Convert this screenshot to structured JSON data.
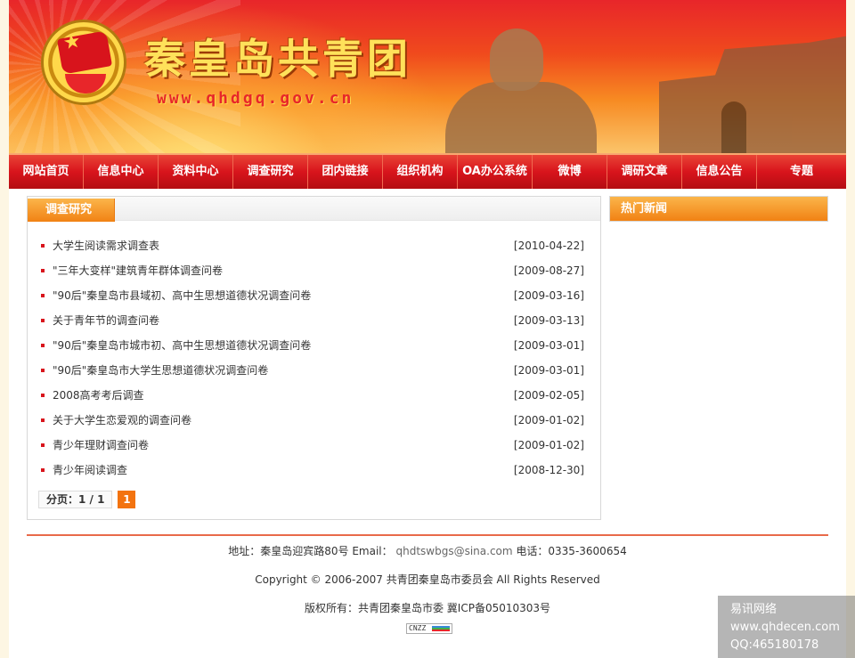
{
  "header": {
    "title": "秦皇岛共青团",
    "url": "www.qhdgq.gov.cn"
  },
  "nav": [
    {
      "label": "网站首页",
      "w": 84
    },
    {
      "label": "信息中心",
      "w": 84
    },
    {
      "label": "资料中心",
      "w": 84
    },
    {
      "label": "调查研究",
      "w": 84
    },
    {
      "label": "团内链接",
      "w": 84
    },
    {
      "label": "组织机构",
      "w": 84
    },
    {
      "label": "OA办公系统",
      "w": 84
    },
    {
      "label": "微博",
      "w": 84
    },
    {
      "label": "调研文章",
      "w": 84
    },
    {
      "label": "信息公告",
      "w": 84
    },
    {
      "label": "专题",
      "w": 100
    }
  ],
  "survey": {
    "title": "调查研究",
    "items": [
      {
        "title": "大学生阅读需求调查表",
        "date": "[2010-04-22]"
      },
      {
        "title": "\"三年大变样\"建筑青年群体调查问卷",
        "date": "[2009-08-27]"
      },
      {
        "title": "\"90后\"秦皇岛市县域初、高中生思想道德状况调查问卷",
        "date": "[2009-03-16]"
      },
      {
        "title": "关于青年节的调查问卷",
        "date": "[2009-03-13]"
      },
      {
        "title": "\"90后\"秦皇岛市城市初、高中生思想道德状况调查问卷",
        "date": "[2009-03-01]"
      },
      {
        "title": "\"90后\"秦皇岛市大学生思想道德状况调查问卷",
        "date": "[2009-03-01]"
      },
      {
        "title": "2008高考考后调查",
        "date": "[2009-02-05]"
      },
      {
        "title": "关于大学生恋爱观的调查问卷",
        "date": "[2009-01-02]"
      },
      {
        "title": "青少年理财调查问卷",
        "date": "[2009-01-02]"
      },
      {
        "title": "青少年阅读调查",
        "date": "[2008-12-30]"
      }
    ],
    "pager": {
      "info": "分页：1 / 1",
      "current": "1"
    }
  },
  "hot_news": {
    "title": "热门新闻"
  },
  "footer": {
    "address": "地址：秦皇岛迎宾路80号 Email：",
    "email": "qhdtswbgs@sina.com",
    "phone": " 电话：0335-3600654",
    "copyright": "Copyright © 2006-2007 共青团秦皇岛市委员会 All Rights Reserved",
    "owner": "版权所有：共青团秦皇岛市委 冀ICP备05010303号",
    "counter": "CNZZ"
  },
  "watermark": {
    "line1": "易讯网络",
    "line2": "www.qhdecen.com",
    "line3": "QQ:465180178"
  }
}
